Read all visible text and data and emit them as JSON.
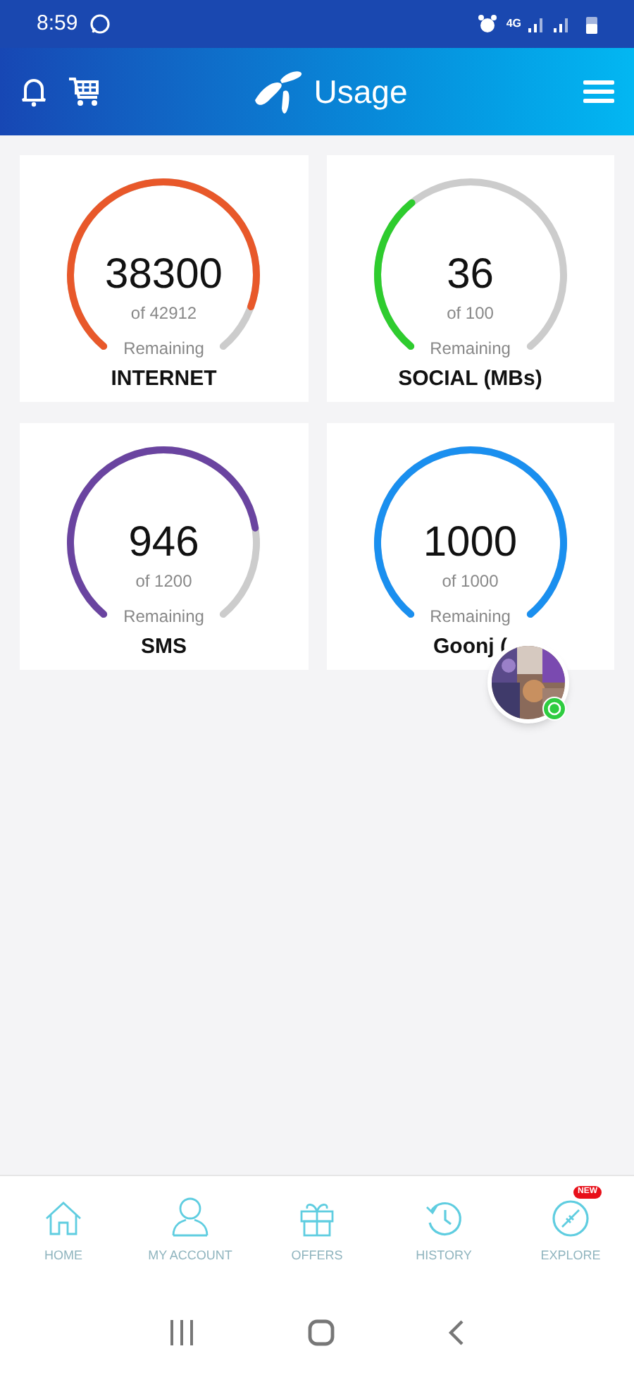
{
  "status_bar": {
    "time": "8:59",
    "network": "4G"
  },
  "header": {
    "title": "Usage"
  },
  "gauges": [
    {
      "value": "38300",
      "total": "of 42912",
      "caption": "Remaining",
      "label": "INTERNET",
      "color": "#e8582a"
    },
    {
      "value": "36",
      "total": "of 100",
      "caption": "Remaining",
      "label": "SOCIAL (MBs)",
      "color": "#2ecc2e"
    },
    {
      "value": "946",
      "total": "of 1200",
      "caption": "Remaining",
      "label": "SMS",
      "color": "#6a44a0"
    },
    {
      "value": "1000",
      "total": "of 1000",
      "caption": "Remaining",
      "label": "Goonj (",
      "color": "#1a8fef"
    }
  ],
  "bottom_nav": [
    {
      "kind": "home",
      "label": "HOME"
    },
    {
      "kind": "account",
      "label": "MY ACCOUNT"
    },
    {
      "kind": "offers",
      "label": "OFFERS"
    },
    {
      "kind": "history",
      "label": "HISTORY"
    },
    {
      "kind": "explore",
      "label": "EXPLORE",
      "badge": "NEW"
    }
  ]
}
